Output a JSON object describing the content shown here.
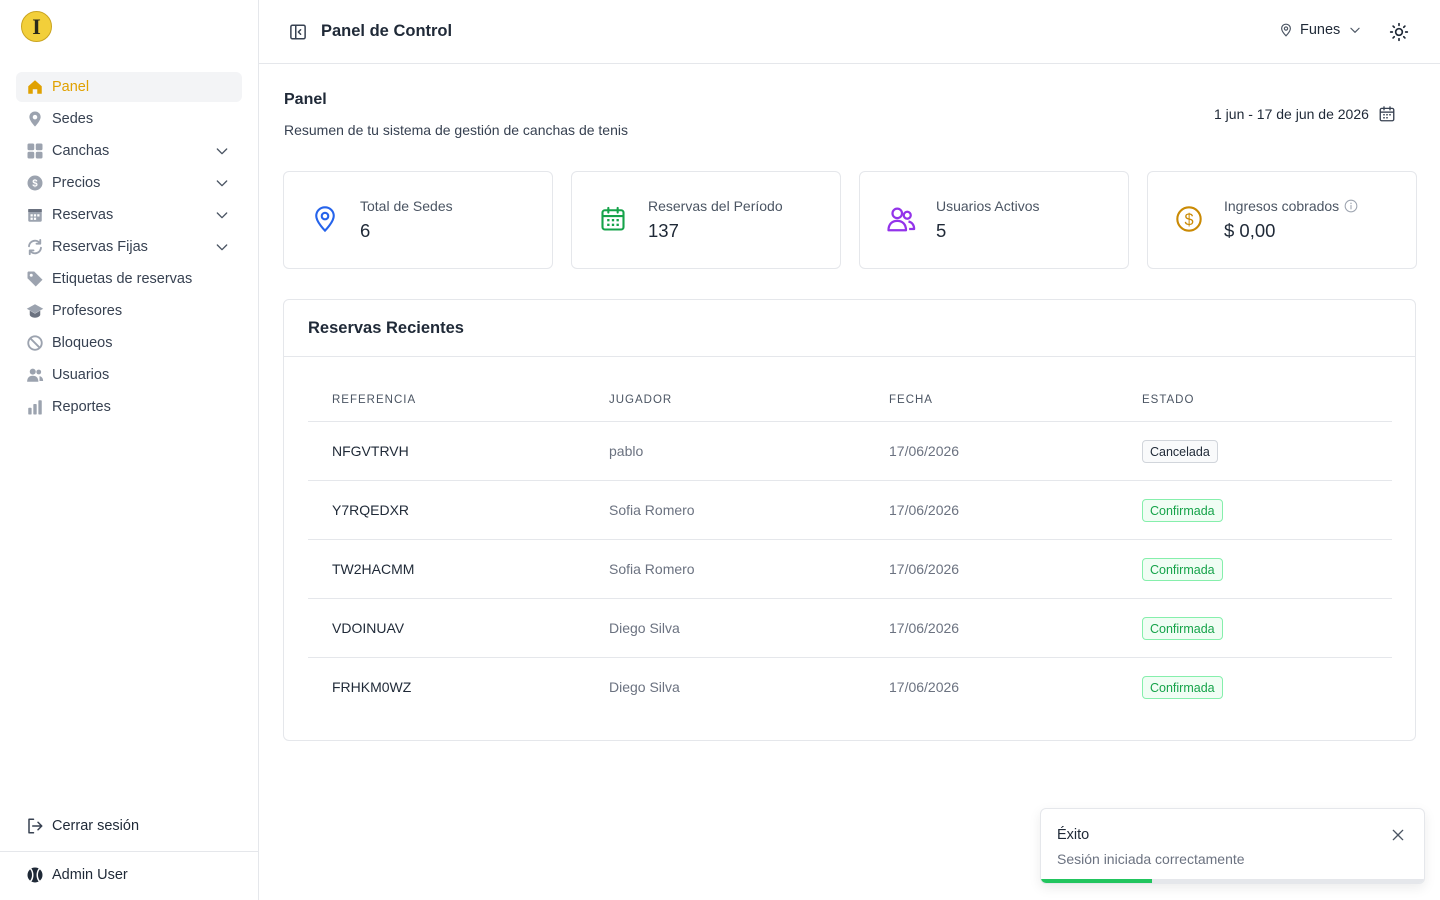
{
  "sidebar": {
    "logo_letter": "I",
    "items": [
      {
        "label": "Panel",
        "icon": "home-icon",
        "active": true
      },
      {
        "label": "Sedes",
        "icon": "map-pin-icon"
      },
      {
        "label": "Canchas",
        "icon": "grid-icon",
        "expandable": true
      },
      {
        "label": "Precios",
        "icon": "dollar-icon",
        "expandable": true
      },
      {
        "label": "Reservas",
        "icon": "calendar-icon",
        "expandable": true
      },
      {
        "label": "Reservas Fijas",
        "icon": "refresh-icon",
        "expandable": true
      },
      {
        "label": "Etiquetas de reservas",
        "icon": "tag-icon"
      },
      {
        "label": "Profesores",
        "icon": "graduation-cap-icon"
      },
      {
        "label": "Bloqueos",
        "icon": "ban-icon"
      },
      {
        "label": "Usuarios",
        "icon": "users-icon"
      },
      {
        "label": "Reportes",
        "icon": "bar-chart-icon"
      }
    ],
    "logout_label": "Cerrar sesión",
    "user_name": "Admin User"
  },
  "header": {
    "title": "Panel de Control",
    "location": "Funes"
  },
  "main": {
    "title": "Panel",
    "subtitle": "Resumen de tu sistema de gestión de canchas de tenis",
    "date_range": "1 jun - 17 de jun de 2026",
    "stats": [
      {
        "label": "Total de Sedes",
        "value": "6",
        "icon": "map-pin-icon",
        "color": "#2563eb"
      },
      {
        "label": "Reservas del Período",
        "value": "137",
        "icon": "calendar-icon",
        "color": "#16a34a"
      },
      {
        "label": "Usuarios Activos",
        "value": "5",
        "icon": "users-icon",
        "color": "#9333ea"
      },
      {
        "label": "Ingresos cobrados",
        "value": "$ 0,00",
        "icon": "dollar-icon",
        "color": "#ca8a04"
      }
    ]
  },
  "recent": {
    "title": "Reservas Recientes",
    "columns": [
      "Referencia",
      "Jugador",
      "Fecha",
      "Estado"
    ],
    "rows": [
      {
        "ref": "NFGVTRVH",
        "player": "pablo",
        "date": "17/06/2026",
        "status": "Cancelada",
        "kind": "cancel"
      },
      {
        "ref": "Y7RQEDXR",
        "player": "Sofia Romero",
        "date": "17/06/2026",
        "status": "Confirmada",
        "kind": "ok"
      },
      {
        "ref": "TW2HACMM",
        "player": "Sofia Romero",
        "date": "17/06/2026",
        "status": "Confirmada",
        "kind": "ok"
      },
      {
        "ref": "VDOINUAV",
        "player": "Diego Silva",
        "date": "17/06/2026",
        "status": "Confirmada",
        "kind": "ok"
      },
      {
        "ref": "FRHKM0WZ",
        "player": "Diego Silva",
        "date": "17/06/2026",
        "status": "Confirmada",
        "kind": "ok"
      }
    ]
  },
  "toast": {
    "title": "Éxito",
    "message": "Sesión iniciada correctamente",
    "progress": 0.29
  },
  "colors": {
    "accent": "#e0a100",
    "success": "#16a34a"
  }
}
